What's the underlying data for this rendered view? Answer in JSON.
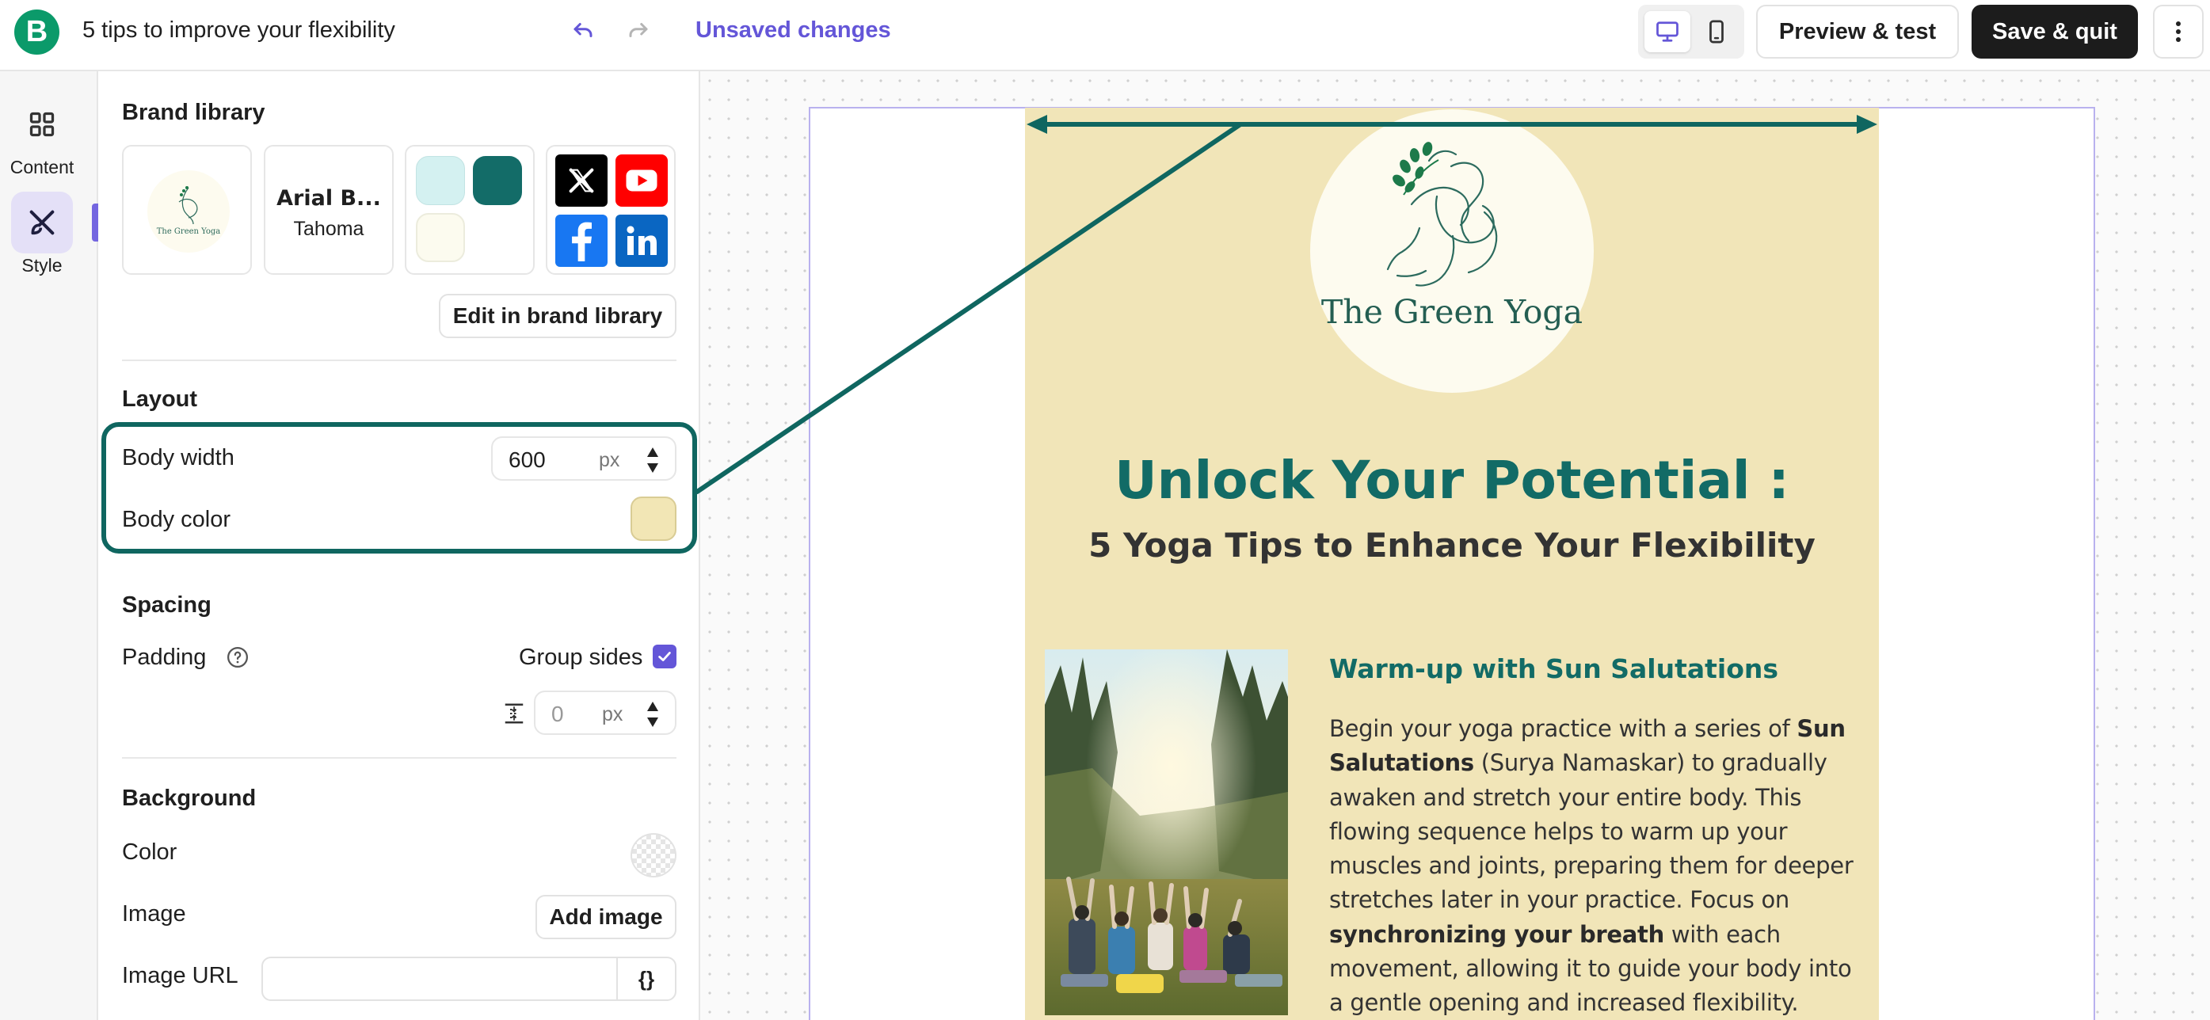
{
  "topbar": {
    "app_logo_letter": "B",
    "doc_title": "5 tips to improve your flexibility",
    "status": "Unsaved changes",
    "preview_label": "Preview & test",
    "save_label": "Save & quit",
    "accent_color": "#6456d8"
  },
  "rail": {
    "items": [
      {
        "label": "Content",
        "icon": "grid-icon"
      },
      {
        "label": "Style",
        "icon": "brush-icon",
        "active": true
      }
    ]
  },
  "panel": {
    "brand_library": {
      "title": "Brand library",
      "logo_text": "The Green Yoga",
      "font_primary": "Arial B...",
      "font_secondary": "Tahoma",
      "colors": [
        "#d4f1f1",
        "#136c68",
        "#fcfbef"
      ],
      "socials": [
        "x-icon",
        "youtube-icon",
        "facebook-icon",
        "linkedin-icon"
      ],
      "edit_label": "Edit in brand library"
    },
    "layout": {
      "title": "Layout",
      "body_width_label": "Body width",
      "body_width_value": "600",
      "body_width_unit": "px",
      "body_color_label": "Body color",
      "body_color": "#f2e6b5"
    },
    "spacing": {
      "title": "Spacing",
      "padding_label": "Padding",
      "group_sides_label": "Group sides",
      "group_sides_checked": true,
      "padding_value": "0",
      "padding_unit": "px"
    },
    "background": {
      "title": "Background",
      "color_label": "Color",
      "image_label": "Image",
      "add_image_label": "Add image",
      "image_url_label": "Image URL",
      "image_url_value": "",
      "merge_tag_symbol": "{}"
    }
  },
  "email": {
    "logo_text": "The Green Yoga",
    "title": "Unlock Your Potential :",
    "subtitle": "5 Yoga Tips to Enhance Your Flexibility",
    "section_heading": "Warm-up with Sun Salutations",
    "paragraph": {
      "p1": "Begin your yoga practice with a series of ",
      "b1": "Sun Salutations",
      "p2": " (Surya Namaskar) to gradually awaken and stretch your entire body. This flowing sequence helps to warm up your muscles and joints, preparing them for deeper stretches later in your practice. Focus on ",
      "b2": "synchronizing your breath",
      "p3": " with each movement, allowing it to guide your body into a gentle opening and increased flexibility."
    },
    "title_color": "#126b66",
    "body_bg": "#f1e5b8"
  }
}
